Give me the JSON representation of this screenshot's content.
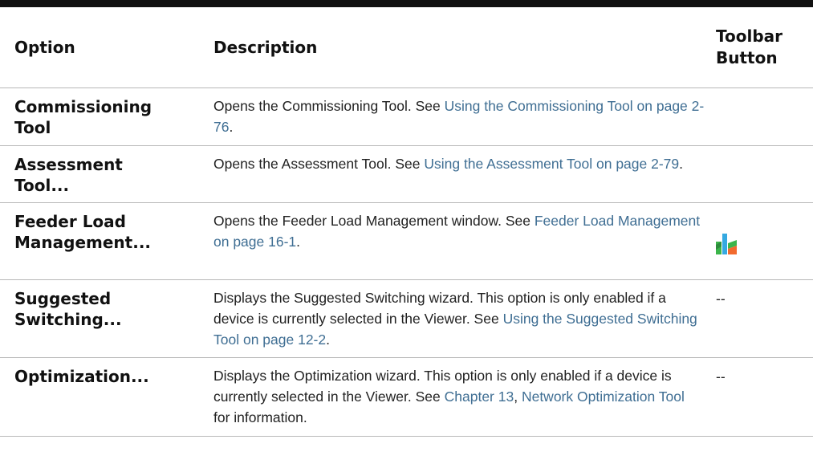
{
  "columns": {
    "option": "Option",
    "description": "Description",
    "toolbar_line1": "Toolbar",
    "toolbar_line2": "Button"
  },
  "rows": [
    {
      "option_line1": "Commissioning",
      "option_line2": "Tool",
      "desc_parts": [
        "Opens the Commissioning Tool. See ",
        "Using the Commissioning Tool on page 2-76",
        "."
      ],
      "toolbar": ""
    },
    {
      "option_line1": "Assessment",
      "option_line2": "Tool...",
      "desc_parts": [
        "Opens the Assessment Tool. See ",
        "Using the Assessment Tool on page 2-79",
        "."
      ],
      "toolbar": ""
    },
    {
      "option_line1": "Feeder Load",
      "option_line2": "Management...",
      "desc_parts": [
        "Opens the Feeder Load Management window. See ",
        "Feeder Load Management on page 16-1",
        "."
      ],
      "toolbar_icon": "feeder-load-management-icon"
    },
    {
      "option_line1": "Suggested",
      "option_line2": "Switching...",
      "desc_parts": [
        "Displays the Suggested Switching wizard. This option is only enabled if a device is currently selected in the Viewer. See ",
        "Using the Suggested Switching Tool on page 12-2",
        "."
      ],
      "toolbar": "--"
    },
    {
      "option_line1": "Optimization...",
      "desc_parts": [
        "Displays the Optimization wizard. This option is only enabled if a device is currently selected in the Viewer. See ",
        "Chapter 13",
        ", ",
        "Network Optimization Tool",
        " for information."
      ],
      "toolbar": "--"
    }
  ],
  "colors": {
    "link": "#3f6e93",
    "icon_green": "#3bb54a",
    "icon_blue": "#36a9e1",
    "icon_orange": "#f26a2e"
  }
}
